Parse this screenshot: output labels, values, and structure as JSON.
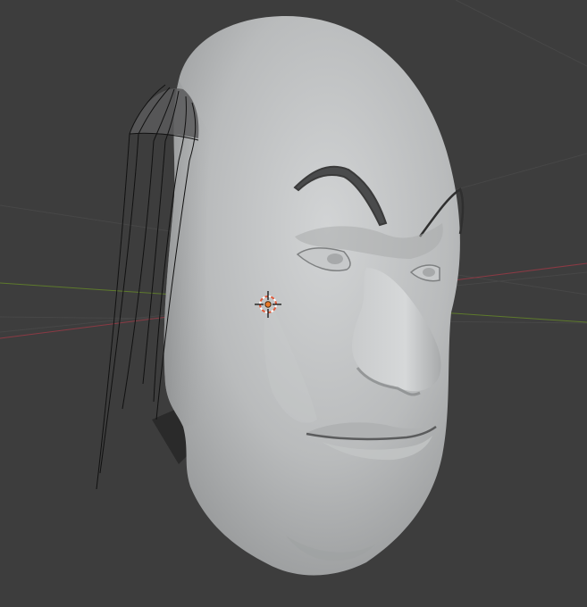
{
  "viewport": {
    "background_color": "#3d3d3d",
    "grid_color": "#474747",
    "x_axis_color": "#8a3a44",
    "y_axis_color": "#5e7a2c",
    "mesh_color": "#c4c6c7",
    "wire_color": "#111111",
    "cursor_color": "#e87a2b"
  },
  "scene": {
    "object": "head-mesh",
    "overlay_curves": "hair-guide-curves",
    "cursor": "3d-cursor-icon"
  }
}
